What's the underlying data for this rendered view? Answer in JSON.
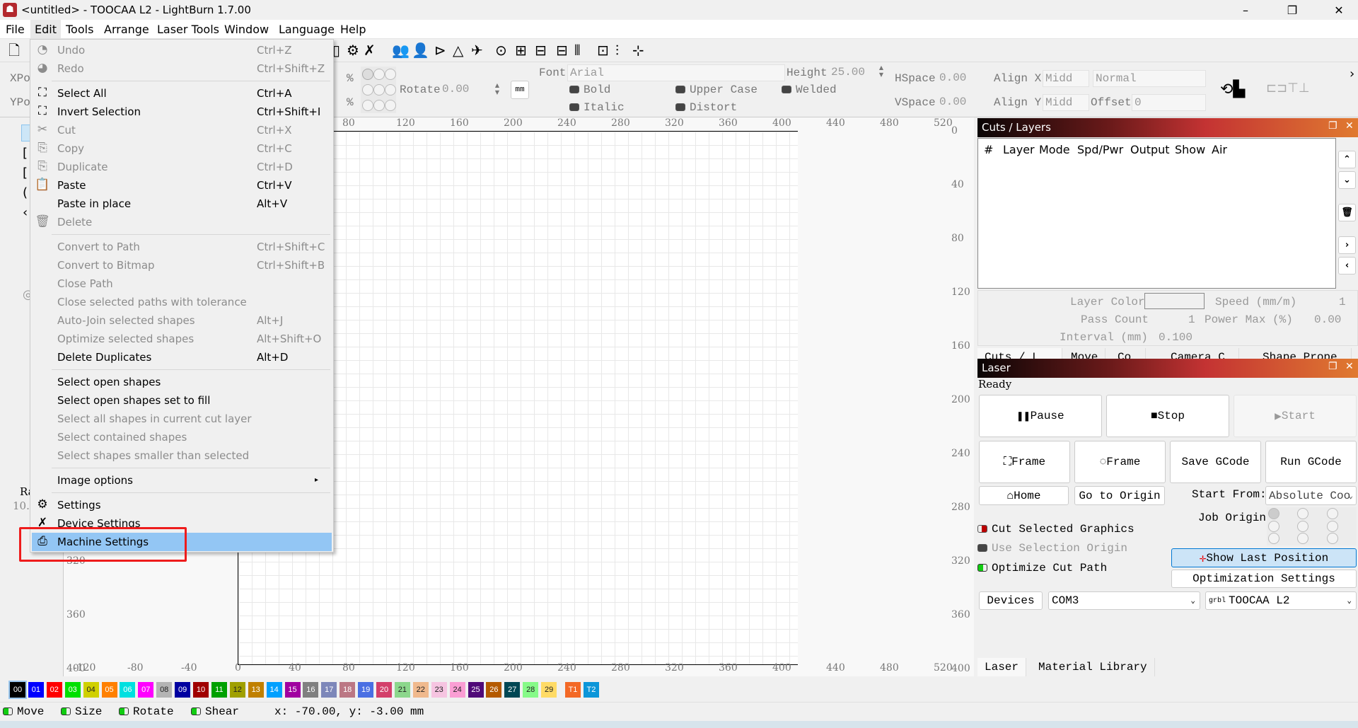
{
  "window": {
    "title": "<untitled> - TOOCAA L2 - LightBurn 1.7.00",
    "minimize": "–",
    "restore": "❐",
    "close": "✕"
  },
  "menubar": [
    "File",
    "Edit",
    "Tools",
    "Arrange",
    "Laser Tools",
    "Window",
    "Language",
    "Help"
  ],
  "edit_menu": [
    {
      "label": "Undo",
      "shortcut": "Ctrl+Z",
      "enabled": false,
      "icon": "undo-icon",
      "glyph": "◔"
    },
    {
      "label": "Redo",
      "shortcut": "Ctrl+Shift+Z",
      "enabled": false,
      "icon": "redo-icon",
      "glyph": "◕"
    },
    {
      "sep": true
    },
    {
      "label": "Select All",
      "shortcut": "Ctrl+A",
      "enabled": true,
      "icon": "select-all-icon",
      "glyph": "⛶"
    },
    {
      "label": "Invert Selection",
      "shortcut": "Ctrl+Shift+I",
      "enabled": true,
      "icon": "invert-selection-icon",
      "glyph": "⛶"
    },
    {
      "label": "Cut",
      "shortcut": "Ctrl+X",
      "enabled": false,
      "icon": "scissors-icon",
      "glyph": "✂"
    },
    {
      "label": "Copy",
      "shortcut": "Ctrl+C",
      "enabled": false,
      "icon": "copy-icon",
      "glyph": "⎘"
    },
    {
      "label": "Duplicate",
      "shortcut": "Ctrl+D",
      "enabled": false,
      "icon": "duplicate-icon",
      "glyph": "⎘"
    },
    {
      "label": "Paste",
      "shortcut": "Ctrl+V",
      "enabled": true,
      "icon": "paste-icon",
      "glyph": "📋"
    },
    {
      "label": "Paste in place",
      "shortcut": "Alt+V",
      "enabled": true,
      "icon": "",
      "glyph": ""
    },
    {
      "label": "Delete",
      "shortcut": "",
      "enabled": false,
      "icon": "trash-icon",
      "glyph": "🗑"
    },
    {
      "sep": true
    },
    {
      "label": "Convert to Path",
      "shortcut": "Ctrl+Shift+C",
      "enabled": false
    },
    {
      "label": "Convert to Bitmap",
      "shortcut": "Ctrl+Shift+B",
      "enabled": false
    },
    {
      "label": "Close Path",
      "shortcut": "",
      "enabled": false
    },
    {
      "label": "Close selected paths with tolerance",
      "shortcut": "",
      "enabled": false
    },
    {
      "label": "Auto-Join selected shapes",
      "shortcut": "Alt+J",
      "enabled": false
    },
    {
      "label": "Optimize selected shapes",
      "shortcut": "Alt+Shift+O",
      "enabled": false
    },
    {
      "label": "Delete Duplicates",
      "shortcut": "Alt+D",
      "enabled": true
    },
    {
      "sep": true
    },
    {
      "label": "Select open shapes",
      "shortcut": "",
      "enabled": true
    },
    {
      "label": "Select open shapes set to fill",
      "shortcut": "",
      "enabled": true
    },
    {
      "label": "Select all shapes in current cut layer",
      "shortcut": "",
      "enabled": false
    },
    {
      "label": "Select contained shapes",
      "shortcut": "",
      "enabled": false
    },
    {
      "label": "Select shapes smaller than selected",
      "shortcut": "",
      "enabled": false
    },
    {
      "sep": true
    },
    {
      "label": "Image options",
      "shortcut": "▸",
      "enabled": true
    },
    {
      "sep": true
    },
    {
      "label": "Settings",
      "shortcut": "",
      "enabled": true,
      "icon": "gears-icon",
      "glyph": "⚙"
    },
    {
      "label": "Device Settings",
      "shortcut": "",
      "enabled": true,
      "icon": "wrench-icon",
      "glyph": "✗"
    },
    {
      "label": "Machine Settings",
      "shortcut": "",
      "enabled": true,
      "icon": "machine-icon",
      "glyph": "⎙",
      "highlighted": true
    }
  ],
  "props": {
    "xpos": "XPo",
    "ypos": "YPo",
    "pct": "%",
    "rotate_label": "Rotate",
    "rotate": "0.00",
    "unit": "mm",
    "font_label": "Font",
    "font": "Arial",
    "height_label": "Height",
    "height": "25.00",
    "bold": "Bold",
    "italic": "Italic",
    "upper": "Upper Case",
    "distort": "Distort",
    "welded": "Welded",
    "hspace_label": "HSpace",
    "hspace": "0.00",
    "vspace_label": "VSpace",
    "vspace": "0.00",
    "alignx_label": "Align X",
    "alignx": "Midd",
    "aligny_label": "Align Y",
    "aligny": "Midd",
    "style": "Normal",
    "offset_label": "Offset",
    "offset": "0"
  },
  "left_tools": {
    "radius_label": "Rad",
    "radius_value": "10."
  },
  "rulers": {
    "x": [
      "-120",
      "-80",
      "-40",
      "0",
      "40",
      "80",
      "120",
      "160",
      "200",
      "240",
      "280",
      "320",
      "360",
      "400",
      "440",
      "480",
      "520"
    ],
    "y": [
      "0",
      "40",
      "80",
      "120",
      "160",
      "200",
      "240",
      "280",
      "320",
      "360",
      "400"
    ]
  },
  "palette": [
    {
      "label": "00",
      "color": "#000000"
    },
    {
      "label": "01",
      "color": "#0000ff"
    },
    {
      "label": "02",
      "color": "#ff0000"
    },
    {
      "label": "03",
      "color": "#00e000"
    },
    {
      "label": "04",
      "color": "#d0d000"
    },
    {
      "label": "05",
      "color": "#ff8000"
    },
    {
      "label": "06",
      "color": "#00e0e0"
    },
    {
      "label": "07",
      "color": "#ff00ff"
    },
    {
      "label": "08",
      "color": "#b4b4b4"
    },
    {
      "label": "09",
      "color": "#0000a0"
    },
    {
      "label": "10",
      "color": "#a00000"
    },
    {
      "label": "11",
      "color": "#00a000"
    },
    {
      "label": "12",
      "color": "#a0a000"
    },
    {
      "label": "13",
      "color": "#c08000"
    },
    {
      "label": "14",
      "color": "#00a0ff"
    },
    {
      "label": "15",
      "color": "#a000a0"
    },
    {
      "label": "16",
      "color": "#808080"
    },
    {
      "label": "17",
      "color": "#7d87b9"
    },
    {
      "label": "18",
      "color": "#bb7784"
    },
    {
      "label": "19",
      "color": "#4a6fe3"
    },
    {
      "label": "20",
      "color": "#d33f6a"
    },
    {
      "label": "21",
      "color": "#8cd78c"
    },
    {
      "label": "22",
      "color": "#f0b98d"
    },
    {
      "label": "23",
      "color": "#f6c4e1"
    },
    {
      "label": "24",
      "color": "#fa9ed4"
    },
    {
      "label": "25",
      "color": "#500a78"
    },
    {
      "label": "26",
      "color": "#b45a00"
    },
    {
      "label": "27",
      "color": "#004754"
    },
    {
      "label": "28",
      "color": "#86fa88"
    },
    {
      "label": "29",
      "color": "#ffdb66"
    },
    {
      "label": "T1",
      "color": "#f36926"
    },
    {
      "label": "T2",
      "color": "#0c96d9"
    }
  ],
  "status": {
    "move": "Move",
    "size": "Size",
    "rotate": "Rotate",
    "shear": "Shear",
    "coords": "x: -70.00, y: -3.00 mm"
  },
  "cuts_layers": {
    "title": "Cuts / Layers",
    "columns": [
      "#",
      "Layer",
      "Mode",
      "Spd/Pwr",
      "Output",
      "Show",
      "Air"
    ],
    "layer_color": "Layer Color",
    "speed_label": "Speed (mm/m)",
    "speed": "1",
    "pass_label": "Pass Count",
    "pass": "1",
    "power_label": "Power Max (%)",
    "power": "0.00",
    "interval_label": "Interval (mm)",
    "interval": "0.100"
  },
  "tabs": [
    "Cuts / L…",
    "Move",
    "Co…",
    "Camera C…",
    "Shape Prope…"
  ],
  "laser": {
    "title": "Laser",
    "status": "Ready",
    "pause": "Pause",
    "stop": "Stop",
    "start": "Start",
    "frame1": "Frame",
    "frame2": "Frame",
    "save_gcode": "Save GCode",
    "run_gcode": "Run GCode",
    "home": "Home",
    "go_origin": "Go to Origin",
    "start_from_label": "Start From:",
    "start_from": "Absolute Coo",
    "job_origin": "Job Origin",
    "cut_selected": "Cut Selected Graphics",
    "use_selection": "Use Selection Origin",
    "optimize": "Optimize Cut Path",
    "show_last": "Show Last Position",
    "opt_settings": "Optimization Settings",
    "devices": "Devices",
    "port": "COM3",
    "device_prefix": "grbl",
    "device": "TOOCAA L2"
  },
  "bottom_tabs": [
    "Laser",
    "Material Library"
  ]
}
